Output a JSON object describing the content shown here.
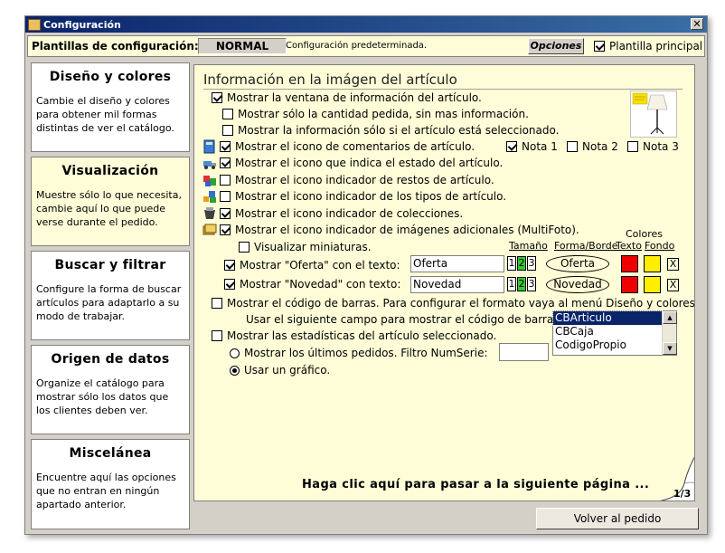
{
  "window": {
    "title": "Configuración",
    "close_label": "✕"
  },
  "toolbar": {
    "label": "Plantillas de configuración:",
    "mode": "NORMAL",
    "description": "Configuración predeterminada.",
    "options_label": "Opciones",
    "main_template_label": "Plantilla principal",
    "main_template_checked": true
  },
  "sidebar": [
    {
      "title": "Diseño y colores",
      "description": "Cambie el diseño y colores para obtener mil formas distintas de ver el catálogo."
    },
    {
      "title": "Visualización",
      "description": "Muestre sólo lo que necesita, cambie aquí lo que puede verse durante el pedido."
    },
    {
      "title": "Buscar y filtrar",
      "description": "Configure la forma de buscar artículos para adaptarlo a su modo de trabajar."
    },
    {
      "title": "Origen de datos",
      "description": "Organize el catálogo para mostrar sólo los datos que los clientes deben ver."
    },
    {
      "title": "Miscelánea",
      "description": "Encuentre aquí las opciones que no entran en ningún apartado anterior."
    }
  ],
  "main": {
    "title": "Información en la imágen del artículo",
    "options": [
      {
        "label": "Mostrar la ventana de información del artículo.",
        "checked": true
      },
      {
        "label": "Mostrar sólo la cantidad pedida, sin mas información.",
        "checked": false
      },
      {
        "label": "Mostrar la información sólo si el artículo está seleccionado.",
        "checked": false
      },
      {
        "label": "Mostrar el icono de comentarios de artículo.",
        "checked": true
      },
      {
        "label": "Mostrar el icono que indica el estado del artículo.",
        "checked": true
      },
      {
        "label": "Mostrar el icono indicador de restos de artículo.",
        "checked": false
      },
      {
        "label": "Mostrar el icono indicador de los tipos de artículo.",
        "checked": false
      },
      {
        "label": "Mostrar el icono indicador de colecciones.",
        "checked": true
      },
      {
        "label": "Mostrar el icono indicador de imágenes adicionales (MultiFoto).",
        "checked": true
      },
      {
        "label": "Visualizar miniaturas.",
        "checked": false
      }
    ],
    "notes": [
      {
        "label": "Nota 1",
        "checked": true
      },
      {
        "label": "Nota 2",
        "checked": false
      },
      {
        "label": "Nota 3",
        "checked": false
      }
    ],
    "headers": {
      "colores": "Colores",
      "tamano": "Tamaño",
      "forma": "Forma/Borde",
      "texto": "Texto",
      "fondo": "Fondo"
    },
    "labels": [
      {
        "label": "Mostrar \"Oferta\" con el texto:",
        "checked": true,
        "value": "Oferta",
        "size_selected": 2,
        "shape_text": "Oferta",
        "text_color": "#ee0000",
        "bg_color": "#ffee00",
        "x": "X"
      },
      {
        "label": "Mostrar \"Novedad\" con texto:",
        "checked": true,
        "value": "Novedad",
        "size_selected": 2,
        "shape_text": "Novedad",
        "text_color": "#ee0000",
        "bg_color": "#ffee00",
        "x": "X"
      }
    ],
    "sizes": [
      "1",
      "2",
      "3"
    ],
    "barcode": {
      "label": "Mostrar el código de barras. Para configurar el formato vaya al menú Diseño y colores.",
      "checked": false,
      "field_label": "Usar el siguiente campo para mostrar el código de barras:",
      "field_options": [
        "CBArticulo",
        "CBCaja",
        "CodigoPropio"
      ],
      "selected": "CBArticulo"
    },
    "stats": {
      "label": "Mostrar las estadísticas del artículo seleccionado.",
      "checked": false,
      "radio_last": "Mostrar los últimos pedidos. Filtro NumSerie:",
      "radio_last_checked": false,
      "filter_value": "",
      "radio_graph": "Usar un gráfico.",
      "radio_graph_checked": true
    },
    "next_page": "Haga clic aquí para pasar a la siguiente página ...",
    "page": "1/3"
  },
  "footer": {
    "back_label": "Volver al pedido"
  }
}
